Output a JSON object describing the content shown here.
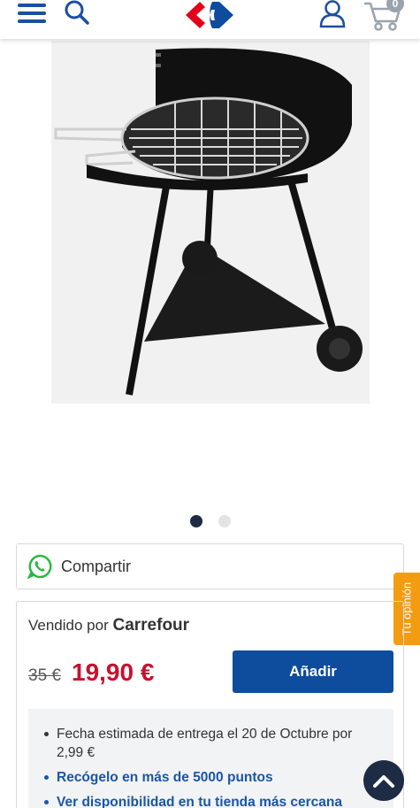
{
  "header": {
    "cart_count": "0"
  },
  "share": {
    "label": "Compartir"
  },
  "opinion_tab": {
    "label": "Tu opinión"
  },
  "seller": {
    "prefix": "Vendido por",
    "name": "Carrefour"
  },
  "pricing": {
    "old_price": "35 €",
    "price": "19,90 €"
  },
  "add_button": {
    "label": "Añadir"
  },
  "info": {
    "delivery": "Fecha estimada de entrega el 20 de Octubre por 2,99 €",
    "pickup": "Recógelo en más de 5000 puntos",
    "store": "Ver disponibilidad en tu tienda más cercana"
  },
  "carousel": {
    "active_index": 0,
    "total": 2
  },
  "colors": {
    "brand_blue": "#0e4c9e",
    "price_red": "#c8102e",
    "opinion_orange": "#f39c12",
    "dark_navy": "#1d2b44"
  }
}
